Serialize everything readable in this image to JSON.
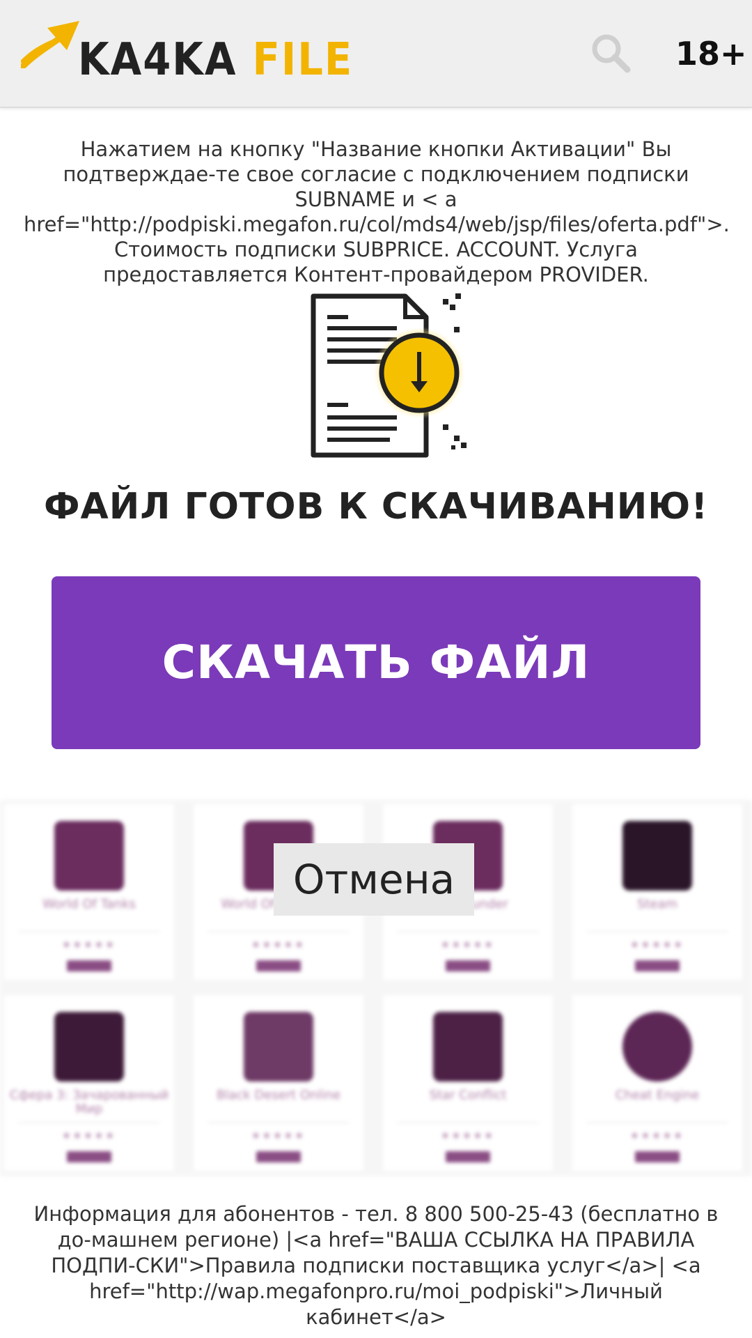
{
  "header": {
    "logo_dark": "KA4KA",
    "logo_accent": "FILE",
    "age_rating": "18+",
    "accent_color": "#f2b400"
  },
  "terms_text": "Нажатием на кнопку \"Название кнопки Активации\" Вы подтверждае-те свое согласие с подключением подписки SUBNAME и < a href=\"http://podpiski.megafon.ru/col/mds4/web/jsp/files/oferta.pdf\">. Стоимость подписки SUBPRICE. ACCOUNT. Услуга предоставляется Контент-провайдером PROVIDER.",
  "main": {
    "ready_title": "ФАЙЛ ГОТОВ К СКАЧИВАНИЮ!",
    "download_label": "СКАЧАТЬ ФАЙЛ",
    "download_color": "#7b3ab9",
    "cancel_label": "Отмена"
  },
  "apps": [
    {
      "name": "World Of Tanks",
      "stars": "★★★★★"
    },
    {
      "name": "World Of Warships",
      "stars": "★★★★★"
    },
    {
      "name": "War Thunder",
      "stars": "★★★★★"
    },
    {
      "name": "Steam",
      "stars": "★★★★★"
    },
    {
      "name": "Сфера 3: Зачарованный Мир",
      "stars": "★★★★★"
    },
    {
      "name": "Black Desert Online",
      "stars": "★★★★★"
    },
    {
      "name": "Star Conflict",
      "stars": "★★★★★"
    },
    {
      "name": "Cheat Engine",
      "stars": "★★★★★"
    }
  ],
  "footer_text": "Информация для абонентов - тел. 8 800 500-25-43 (бесплатно в до-машнем регионе) |<a href=\"ВАША ССЫЛКА НА ПРАВИЛА ПОДПИ-СКИ\">Правила подписки поставщика услуг</a>| <a href=\"http://wap.megafonpro.ru/moi_podpiski\">Личный кабинет</a>"
}
